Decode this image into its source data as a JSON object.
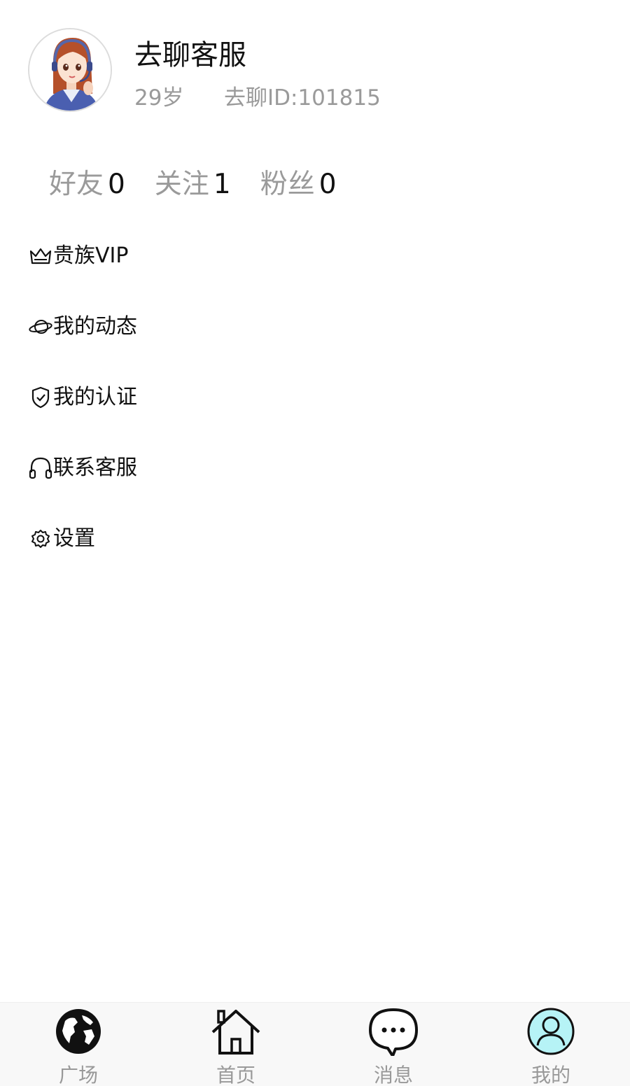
{
  "profile": {
    "name": "去聊客服",
    "age": "29岁",
    "id_text": "去聊ID:101815"
  },
  "stats": [
    {
      "label": "好友",
      "count": "0"
    },
    {
      "label": "关注",
      "count": "1"
    },
    {
      "label": "粉丝",
      "count": "0"
    }
  ],
  "menu": [
    {
      "label": "贵族VIP",
      "icon": "crown-icon"
    },
    {
      "label": "我的动态",
      "icon": "planet-icon"
    },
    {
      "label": "我的认证",
      "icon": "shield-check-icon"
    },
    {
      "label": "联系客服",
      "icon": "headphones-icon"
    },
    {
      "label": "设置",
      "icon": "gear-icon"
    }
  ],
  "tabbar": [
    {
      "label": "广场",
      "icon": "globe-icon"
    },
    {
      "label": "首页",
      "icon": "home-icon"
    },
    {
      "label": "消息",
      "icon": "chat-bubble-icon"
    },
    {
      "label": "我的",
      "icon": "user-icon",
      "active": true
    }
  ],
  "colors": {
    "muted_text": "#9a9a9a",
    "active_tab_fill": "#b6f3f6",
    "tabbar_bg": "#f8f8f8"
  }
}
